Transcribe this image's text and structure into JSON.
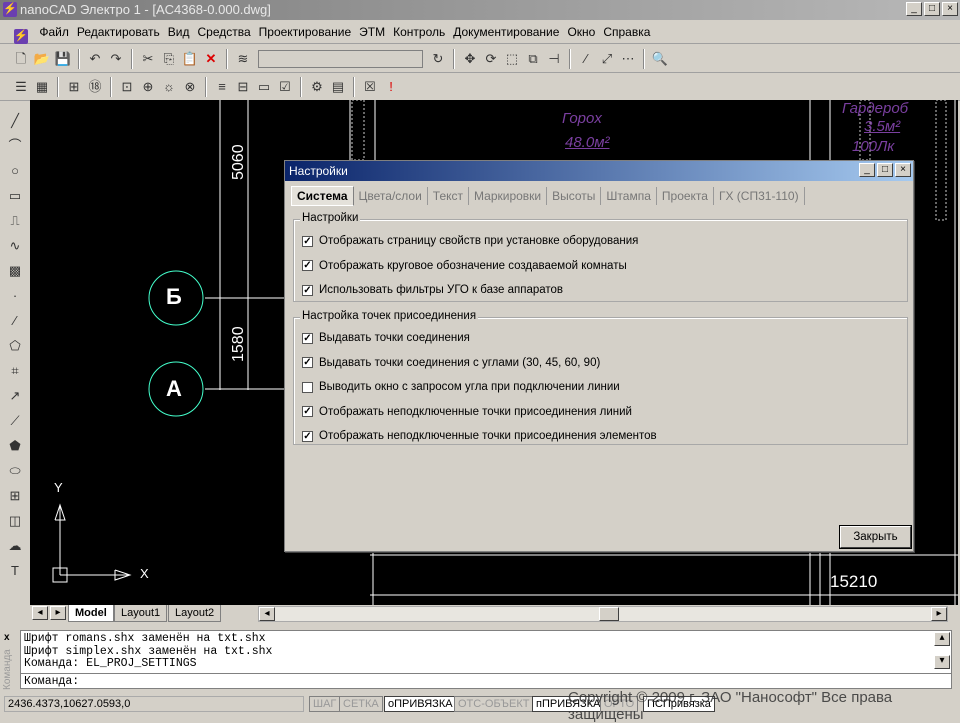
{
  "window": {
    "title": "nanoCAD Электро 1 - [AC4368-0.000.dwg]",
    "min": "_",
    "max": "□",
    "close": "×"
  },
  "menu": [
    "Файл",
    "Редактировать",
    "Вид",
    "Средства",
    "Проектирование",
    "ЭТМ",
    "Контроль",
    "Документирование",
    "Окно",
    "Справка"
  ],
  "drawing": {
    "room1_name": "Гороx",
    "room1_area": "48.0м²",
    "room2_name": "Гардероб",
    "room2_area": "3.5м²",
    "room2_lux": "100Лк",
    "dim1": "5060",
    "dim2": "1580",
    "dim3": "15210",
    "axis_b": "Б",
    "axis_a": "А",
    "ucs_y": "Y",
    "ucs_x": "X"
  },
  "layout_tabs": [
    "Model",
    "Layout1",
    "Layout2"
  ],
  "command": {
    "lines": [
      "Шрифт romans.shx заменён на txt.shx",
      "Шрифт simplex.shx заменён на txt.shx",
      "Команда: EL_PROJ_SETTINGS"
    ],
    "prompt": "Команда:",
    "panel_label": "Команда"
  },
  "status": {
    "coords": "2436.4373,10627.0593,0",
    "buttons": [
      {
        "label": "ШАГ",
        "on": false
      },
      {
        "label": "СЕТКА",
        "on": false
      },
      {
        "label": "оПРИВЯЗКА",
        "on": true
      },
      {
        "label": "ОТС-ОБЪЕКТ",
        "on": false
      },
      {
        "label": "пПРИВЯЗКА",
        "on": true
      },
      {
        "label": "ОРТО",
        "on": false
      },
      {
        "label": "ПСПривязка",
        "on": true
      }
    ],
    "copyright": "Copyright © 2009 г. ЗАО \"Нанософт\" Все права защищены"
  },
  "dialog": {
    "title": "Настройки",
    "tabs": [
      "Система",
      "Цвета/слои",
      "Текст",
      "Маркировки",
      "Высоты",
      "Штампа",
      "Проекта",
      "ГХ (СП31-110)"
    ],
    "group1": {
      "title": "Настройки",
      "items": [
        {
          "label": "Отображать страницу свойств при установке оборудования",
          "checked": true
        },
        {
          "label": "Отображать круговое обозначение создаваемой комнаты",
          "checked": true
        },
        {
          "label": "Использовать фильтры УГО к базе аппаратов",
          "checked": true
        }
      ]
    },
    "group2": {
      "title": "Настройка точек присоединения",
      "items": [
        {
          "label": "Выдавать точки соединения",
          "checked": true
        },
        {
          "label": "Выдавать точки соединения с углами (30, 45, 60, 90)",
          "checked": true
        },
        {
          "label": "Выводить окно с запросом угла при подключении линии",
          "checked": false
        },
        {
          "label": "Отображать неподключенные точки присоединения линий",
          "checked": true
        },
        {
          "label": "Отображать неподключенные точки присоединения элементов",
          "checked": true
        }
      ]
    },
    "close_label": "Закрыть"
  }
}
